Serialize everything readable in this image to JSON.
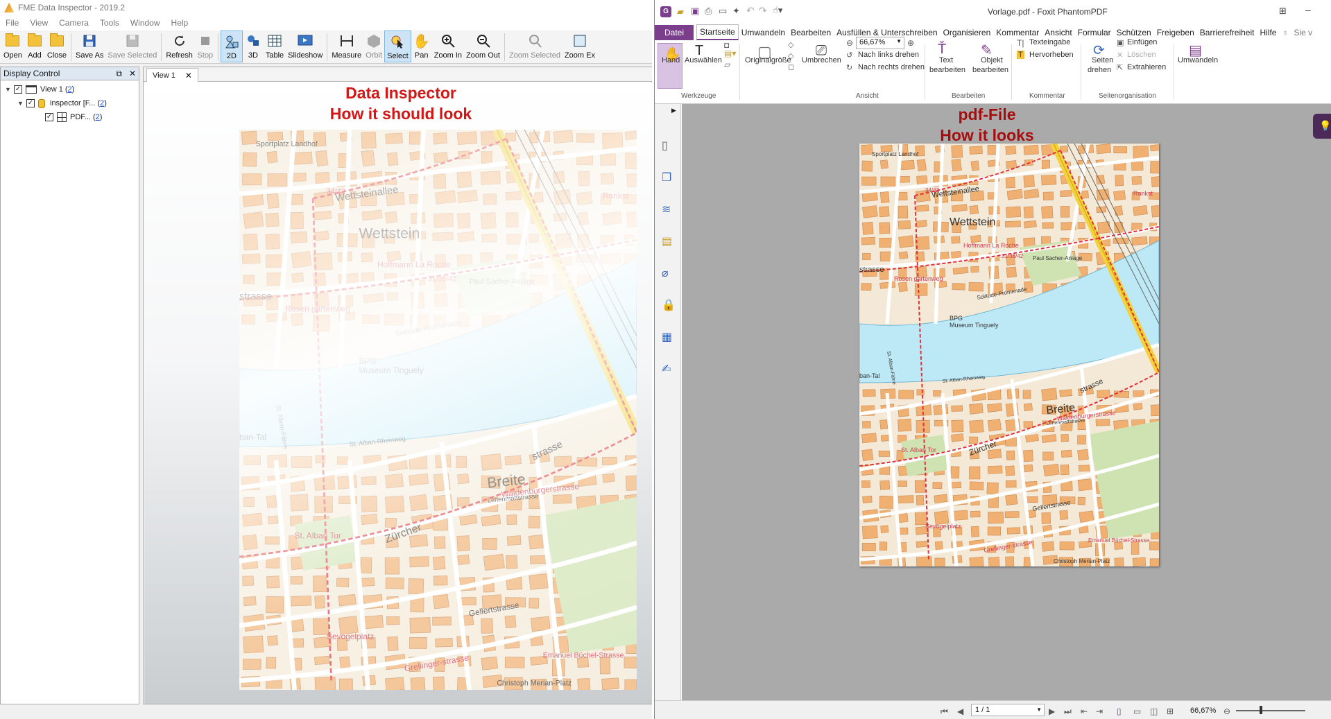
{
  "fme": {
    "window_title": "FME Data Inspector - 2019.2",
    "menu": [
      "File",
      "View",
      "Camera",
      "Tools",
      "Window",
      "Help"
    ],
    "toolbar": [
      {
        "label": "Open",
        "icon": "folder-open-icon",
        "enabled": true
      },
      {
        "label": "Add",
        "icon": "folder-add-icon",
        "enabled": true
      },
      {
        "label": "Close",
        "icon": "folder-close-icon",
        "enabled": true
      },
      {
        "label": "Save As",
        "icon": "save-as-icon",
        "enabled": true
      },
      {
        "label": "Save Selected",
        "icon": "save-selected-icon",
        "enabled": false
      },
      {
        "label": "Refresh",
        "icon": "refresh-icon",
        "enabled": true
      },
      {
        "label": "Stop",
        "icon": "stop-icon",
        "enabled": false
      },
      {
        "label": "2D",
        "icon": "shapes-2d-icon",
        "enabled": true,
        "active": true
      },
      {
        "label": "3D",
        "icon": "shapes-3d-icon",
        "enabled": true
      },
      {
        "label": "Table",
        "icon": "table-icon",
        "enabled": true
      },
      {
        "label": "Slideshow",
        "icon": "slideshow-icon",
        "enabled": true
      },
      {
        "label": "Measure",
        "icon": "measure-icon",
        "enabled": true
      },
      {
        "label": "Orbit",
        "icon": "orbit-icon",
        "enabled": false
      },
      {
        "label": "Select",
        "icon": "select-cursor-icon",
        "enabled": true,
        "active": true
      },
      {
        "label": "Pan",
        "icon": "pan-hand-icon",
        "enabled": true
      },
      {
        "label": "Zoom In",
        "icon": "zoom-in-icon",
        "enabled": true
      },
      {
        "label": "Zoom Out",
        "icon": "zoom-out-icon",
        "enabled": true
      },
      {
        "label": "Zoom Selected",
        "icon": "zoom-selected-icon",
        "enabled": false
      },
      {
        "label": "Zoom Ex",
        "icon": "zoom-extents-icon",
        "enabled": true
      }
    ],
    "display_control": {
      "title": "Display Control",
      "tree": [
        {
          "label": "View 1 (",
          "count": "2",
          "suffix": ")",
          "level": 0
        },
        {
          "label": "inspector [F...",
          "count": "2",
          "suffix": "",
          "level": 1
        },
        {
          "label": "PDF... (",
          "count": "2",
          "suffix": ")",
          "level": 2
        }
      ]
    },
    "view_tab": "View 1",
    "heading_line1": "Data Inspector",
    "heading_line2": "How it should look"
  },
  "foxit": {
    "window_title": "Vorlage.pdf - Foxit PhantomPDF",
    "tabs": [
      "Datei",
      "Startseite",
      "Umwandeln",
      "Bearbeiten",
      "Ausfüllen & Unterschreiben",
      "Organisieren",
      "Kommentar",
      "Ansicht",
      "Formular",
      "Schützen",
      "Freigeben",
      "Barrierefreiheit",
      "Hilfe"
    ],
    "search_hint": "Sie v",
    "ribbon": {
      "hand": "Hand",
      "auswaehlen": "Auswählen",
      "werkzeuge": "Werkzeuge",
      "originalgroesse": "Originalgröße",
      "umbrechen": "Umbrechen",
      "zoom": "66,67%",
      "links_drehen": "Nach links drehen",
      "rechts_drehen": "Nach rechts drehen",
      "ansicht": "Ansicht",
      "text_bearbeiten_1": "Text",
      "text_bearbeiten_2": "bearbeiten",
      "objekt_1": "Objekt",
      "objekt_2": "bearbeiten",
      "bearbeiten": "Bearbeiten",
      "texteingabe": "Texteingabe",
      "hervorheben": "Hervorheben",
      "kommentar": "Kommentar",
      "seiten_1": "Seiten",
      "seiten_2": "drehen",
      "einfuegen": "Einfügen",
      "loeschen": "Löschen",
      "extrahieren": "Extrahieren",
      "seitenorganisation": "Seitenorganisation",
      "umwandeln": "Umwandeln"
    },
    "heading_line1": "pdf-File",
    "heading_line2": "How it looks",
    "page_indicator": "1 / 1",
    "zoom_status": "66,67%"
  },
  "map_labels": {
    "wettstein": "Wettstein",
    "wettsteinallee": "Wettsteinallee",
    "breite": "Breite",
    "zuercher": "Zürcher",
    "strasse": "strasse",
    "rhein_label": "BPG",
    "museum": "Museum Tinguely",
    "solitude": "Solitude-Promenade",
    "sportplatz": "Sportplatz Landhof",
    "paul_sacher": "Paul Sacher-Anlage",
    "rosengarten": "Rosen gartenweg",
    "hoffmann": "Hoffmann La Roche",
    "st_alban_tor": "St. Alban Tor",
    "waldenburger": "Waldenburgerstrasse",
    "gellert": "Gellertstrasse",
    "sevogelplatz": "Sevogelplatz",
    "grellinger": "Grellinger-strasse",
    "emanuel": "Emanuel Büchel-Strasse",
    "christoph": "Christoph Merian-Platz",
    "route1": "34/42",
    "route2": "31/38/42",
    "rankst": "Rankst",
    "alban_tal": "ban-Tal",
    "lehenmatt": "Lehenmattstrasse",
    "st_alban_faehre": "St. Alban-Fähre",
    "rhein_weg": "St. Alban-Rheinweg"
  },
  "colors": {
    "heading_red": "#d21717",
    "foxit_purple": "#7b3e8c",
    "map_water": "#bde9f7",
    "map_building": "#f0b071",
    "map_land": "#f3e9d6",
    "map_park": "#cfe3b2"
  }
}
